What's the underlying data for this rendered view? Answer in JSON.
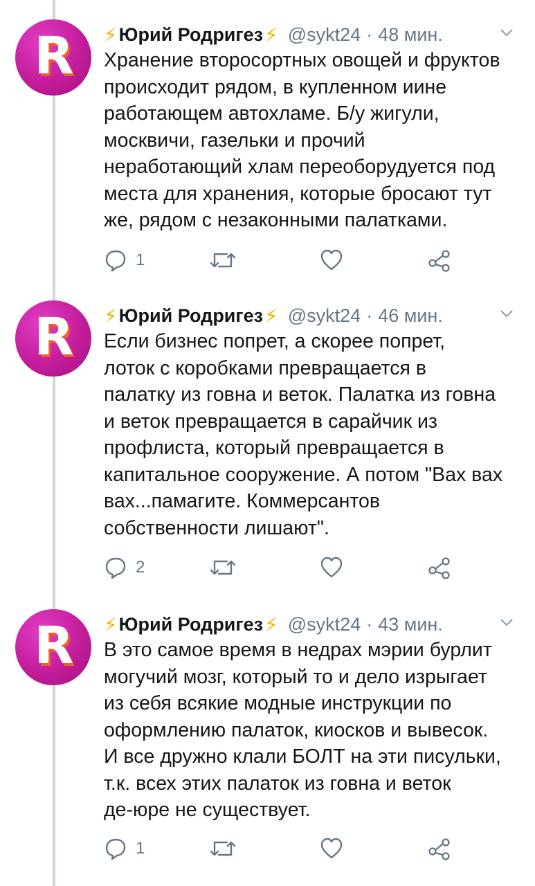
{
  "author": {
    "bolt_left": "⚡",
    "name": "Юрий Родригез",
    "bolt_right": "⚡",
    "handle": "@sykt24",
    "avatar_letter": "R"
  },
  "colors": {
    "avatar": "#c31d9b",
    "avatar_accent": "#f35b2a",
    "thread_line": "#ccd6dd",
    "muted": "#657786",
    "text": "#14171a"
  },
  "icons": {
    "reply": "speech-bubble",
    "retweet": "retweet-arrows",
    "like": "heart",
    "share": "share-nodes",
    "menu": "chevron-down"
  },
  "tweets": [
    {
      "time": "48 мин.",
      "text": "Хранение второсортных овощей и фруктов\nпроисходит рядом, в купленном иине\nработающем автохламе. Б/у жигули,\nмосквичи, газельки и прочий\nнеработающий хлам переоборудуется под\nместа для хранения, которые бросают тут\nже, рядом с незаконными палатками.",
      "replies": "1"
    },
    {
      "time": "46 мин.",
      "text": "Если бизнес попрет, а скорее попрет,\nлоток с коробками превращается в\nпалатку из говна и веток. Палатка из говна\nи веток превращается в сарайчик из\nпрофлиста, который превращается в\nкапитальное сооружение. А потом \"Вах вах\nвах...памагите. Коммерсантов\nсобственности лишают\".",
      "replies": "2"
    },
    {
      "time": "43 мин.",
      "text": "В это самое время в недрах мэрии бурлит\nмогучий мозг, который то и дело изрыгает\nиз себя всякие модные инструкции по\nоформлению палаток, киосков и вывесок.\nИ все дружно клали БОЛТ на эти писульки,\nт.к. всех этих палаток из говна и веток\nде-юре не существует.",
      "replies": "1"
    }
  ]
}
